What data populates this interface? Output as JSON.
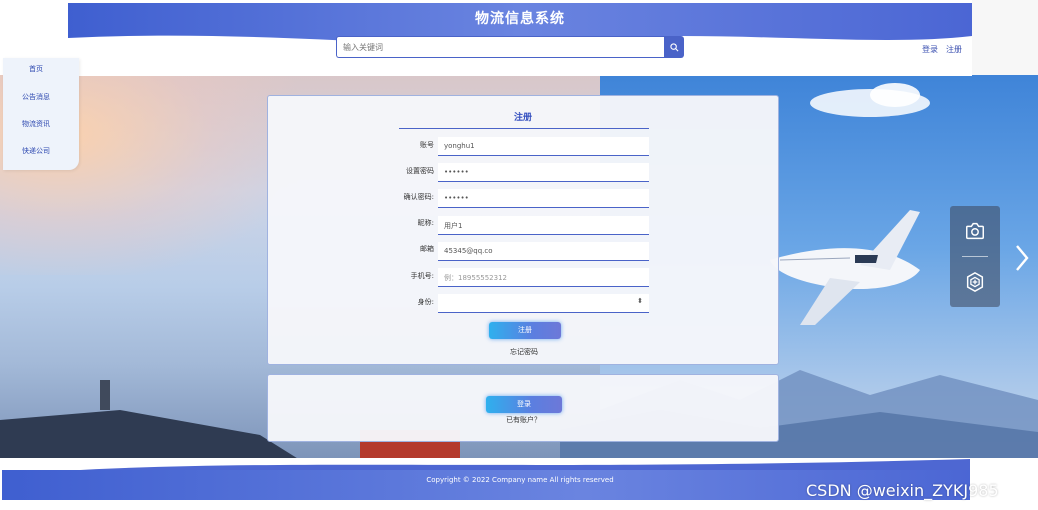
{
  "header": {
    "site_title": "物流信息系统",
    "search_placeholder": "输入关键词",
    "login_link": "登录",
    "register_link": "注册"
  },
  "sidebar": {
    "items": [
      {
        "label": "首页"
      },
      {
        "label": "公告消息"
      },
      {
        "label": "物流资讯"
      },
      {
        "label": "快递公司"
      }
    ]
  },
  "register_form": {
    "title": "注册",
    "fields": [
      {
        "label": "账号",
        "value": "yonghu1",
        "placeholder": ""
      },
      {
        "label": "设置密码",
        "value": "••••••",
        "placeholder": ""
      },
      {
        "label": "确认密码:",
        "value": "••••••",
        "placeholder": ""
      },
      {
        "label": "昵称:",
        "value": "用户1",
        "placeholder": ""
      },
      {
        "label": "邮箱",
        "value": "45345@qq.co",
        "placeholder": ""
      },
      {
        "label": "手机号:",
        "value": "",
        "placeholder": "例：18955552312"
      },
      {
        "label": "身份:",
        "value": "",
        "placeholder": ""
      }
    ],
    "submit_label": "注册",
    "forgot_link": "忘记密码"
  },
  "login_panel": {
    "login_button": "登录",
    "have_account": "已有账户？"
  },
  "footer": {
    "copyright": "Copyright © 2022 Company name All rights reserved"
  },
  "watermark": "CSDN @weixin_ZYKJ985",
  "icons": {
    "search": "search-icon",
    "camera": "camera-icon",
    "shield": "shield-plus-icon",
    "next": "chevron-right-icon"
  },
  "colors": {
    "primary": "#4a63c8",
    "button_gradient_start": "#2fb0ee",
    "button_gradient_end": "#6d78d8"
  }
}
